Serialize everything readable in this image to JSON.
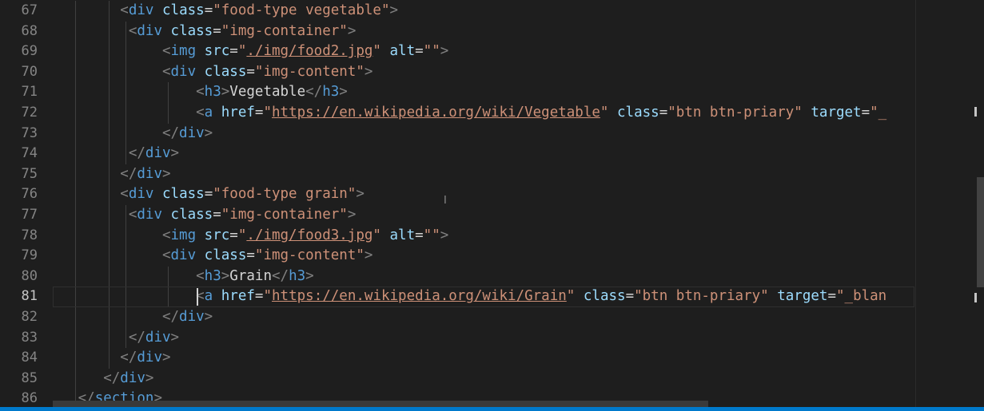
{
  "editor": {
    "language": "html",
    "current_line": 81,
    "colors": {
      "background": "#1e1e1e",
      "line_number": "#858585",
      "tag": "#569cd6",
      "punctuation": "#808080",
      "attribute": "#9cdcfe",
      "string": "#ce9178",
      "text": "#d4d4d4",
      "status_bar": "#007acc"
    },
    "lines": [
      {
        "num": 67,
        "indent": 8,
        "tokens": [
          [
            "punc",
            "<"
          ],
          [
            "tag",
            "div"
          ],
          [
            "text",
            " "
          ],
          [
            "attr",
            "class"
          ],
          [
            "text",
            "="
          ],
          [
            "str",
            "\"food-type vegetable\""
          ],
          [
            "punc",
            ">"
          ]
        ]
      },
      {
        "num": 68,
        "indent": 9,
        "tokens": [
          [
            "punc",
            "<"
          ],
          [
            "tag",
            "div"
          ],
          [
            "text",
            " "
          ],
          [
            "attr",
            "class"
          ],
          [
            "text",
            "="
          ],
          [
            "str",
            "\"img-container\""
          ],
          [
            "punc",
            ">"
          ]
        ]
      },
      {
        "num": 69,
        "indent": 13,
        "tokens": [
          [
            "punc",
            "<"
          ],
          [
            "tag",
            "img"
          ],
          [
            "text",
            " "
          ],
          [
            "attr",
            "src"
          ],
          [
            "text",
            "="
          ],
          [
            "str",
            "\""
          ],
          [
            "link",
            "./img/food2.jpg"
          ],
          [
            "str",
            "\""
          ],
          [
            "text",
            " "
          ],
          [
            "attr",
            "alt"
          ],
          [
            "text",
            "="
          ],
          [
            "str",
            "\"\""
          ],
          [
            "punc",
            ">"
          ]
        ]
      },
      {
        "num": 70,
        "indent": 13,
        "tokens": [
          [
            "punc",
            "<"
          ],
          [
            "tag",
            "div"
          ],
          [
            "text",
            " "
          ],
          [
            "attr",
            "class"
          ],
          [
            "text",
            "="
          ],
          [
            "str",
            "\"img-content\""
          ],
          [
            "punc",
            ">"
          ]
        ]
      },
      {
        "num": 71,
        "indent": 17,
        "tokens": [
          [
            "punc",
            "<"
          ],
          [
            "tag",
            "h3"
          ],
          [
            "punc",
            ">"
          ],
          [
            "text",
            "Vegetable"
          ],
          [
            "punc",
            "</"
          ],
          [
            "tag",
            "h3"
          ],
          [
            "punc",
            ">"
          ]
        ]
      },
      {
        "num": 72,
        "indent": 17,
        "tokens": [
          [
            "punc",
            "<"
          ],
          [
            "tag",
            "a"
          ],
          [
            "text",
            " "
          ],
          [
            "attr",
            "href"
          ],
          [
            "text",
            "="
          ],
          [
            "str",
            "\""
          ],
          [
            "link",
            "https://en.wikipedia.org/wiki/Vegetable"
          ],
          [
            "str",
            "\""
          ],
          [
            "text",
            " "
          ],
          [
            "attr",
            "class"
          ],
          [
            "text",
            "="
          ],
          [
            "str",
            "\"btn btn-priary\""
          ],
          [
            "text",
            " "
          ],
          [
            "attr",
            "target"
          ],
          [
            "text",
            "="
          ],
          [
            "str",
            "\"_"
          ]
        ]
      },
      {
        "num": 73,
        "indent": 13,
        "tokens": [
          [
            "punc",
            "</"
          ],
          [
            "tag",
            "div"
          ],
          [
            "punc",
            ">"
          ]
        ]
      },
      {
        "num": 74,
        "indent": 9,
        "tokens": [
          [
            "punc",
            "</"
          ],
          [
            "tag",
            "div"
          ],
          [
            "punc",
            ">"
          ]
        ]
      },
      {
        "num": 75,
        "indent": 8,
        "tokens": [
          [
            "punc",
            "</"
          ],
          [
            "tag",
            "div"
          ],
          [
            "punc",
            ">"
          ]
        ]
      },
      {
        "num": 76,
        "indent": 8,
        "tokens": [
          [
            "punc",
            "<"
          ],
          [
            "tag",
            "div"
          ],
          [
            "text",
            " "
          ],
          [
            "attr",
            "class"
          ],
          [
            "text",
            "="
          ],
          [
            "str",
            "\"food-type grain\""
          ],
          [
            "punc",
            ">"
          ]
        ]
      },
      {
        "num": 77,
        "indent": 9,
        "tokens": [
          [
            "punc",
            "<"
          ],
          [
            "tag",
            "div"
          ],
          [
            "text",
            " "
          ],
          [
            "attr",
            "class"
          ],
          [
            "text",
            "="
          ],
          [
            "str",
            "\"img-container\""
          ],
          [
            "punc",
            ">"
          ]
        ]
      },
      {
        "num": 78,
        "indent": 13,
        "tokens": [
          [
            "punc",
            "<"
          ],
          [
            "tag",
            "img"
          ],
          [
            "text",
            " "
          ],
          [
            "attr",
            "src"
          ],
          [
            "text",
            "="
          ],
          [
            "str",
            "\""
          ],
          [
            "link",
            "./img/food3.jpg"
          ],
          [
            "str",
            "\""
          ],
          [
            "text",
            " "
          ],
          [
            "attr",
            "alt"
          ],
          [
            "text",
            "="
          ],
          [
            "str",
            "\"\""
          ],
          [
            "punc",
            ">"
          ]
        ]
      },
      {
        "num": 79,
        "indent": 13,
        "tokens": [
          [
            "punc",
            "<"
          ],
          [
            "tag",
            "div"
          ],
          [
            "text",
            " "
          ],
          [
            "attr",
            "class"
          ],
          [
            "text",
            "="
          ],
          [
            "str",
            "\"img-content\""
          ],
          [
            "punc",
            ">"
          ]
        ]
      },
      {
        "num": 80,
        "indent": 17,
        "tokens": [
          [
            "punc",
            "<"
          ],
          [
            "tag",
            "h3"
          ],
          [
            "punc",
            ">"
          ],
          [
            "text",
            "Grain"
          ],
          [
            "punc",
            "</"
          ],
          [
            "tag",
            "h3"
          ],
          [
            "punc",
            ">"
          ]
        ]
      },
      {
        "num": 81,
        "indent": 17,
        "tokens": [
          [
            "punc",
            "<"
          ],
          [
            "tag",
            "a"
          ],
          [
            "text",
            " "
          ],
          [
            "attr",
            "href"
          ],
          [
            "text",
            "="
          ],
          [
            "str",
            "\""
          ],
          [
            "link",
            "https://en.wikipedia.org/wiki/Grain"
          ],
          [
            "str",
            "\""
          ],
          [
            "text",
            " "
          ],
          [
            "attr",
            "class"
          ],
          [
            "text",
            "="
          ],
          [
            "str",
            "\"btn btn-priary\""
          ],
          [
            "text",
            " "
          ],
          [
            "attr",
            "target"
          ],
          [
            "text",
            "="
          ],
          [
            "str",
            "\"_blan"
          ]
        ]
      },
      {
        "num": 82,
        "indent": 13,
        "tokens": [
          [
            "punc",
            "</"
          ],
          [
            "tag",
            "div"
          ],
          [
            "punc",
            ">"
          ]
        ]
      },
      {
        "num": 83,
        "indent": 9,
        "tokens": [
          [
            "punc",
            "</"
          ],
          [
            "tag",
            "div"
          ],
          [
            "punc",
            ">"
          ]
        ]
      },
      {
        "num": 84,
        "indent": 8,
        "tokens": [
          [
            "punc",
            "</"
          ],
          [
            "tag",
            "div"
          ],
          [
            "punc",
            ">"
          ]
        ]
      },
      {
        "num": 85,
        "indent": 6,
        "tokens": [
          [
            "punc",
            "</"
          ],
          [
            "tag",
            "div"
          ],
          [
            "punc",
            ">"
          ]
        ]
      },
      {
        "num": 86,
        "indent": 3,
        "tokens": [
          [
            "punc",
            "</"
          ],
          [
            "tag",
            "section"
          ],
          [
            "punc",
            ">"
          ]
        ]
      }
    ]
  }
}
